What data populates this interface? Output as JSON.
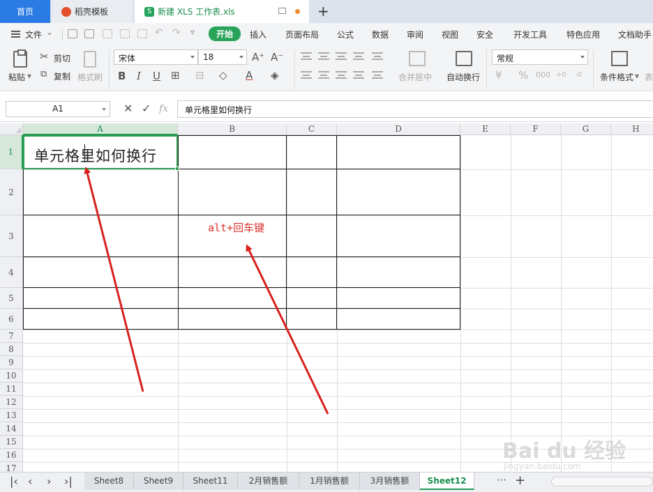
{
  "titlebar": {
    "tabs": [
      {
        "label": "首页",
        "active": false
      },
      {
        "label": "稻壳模板",
        "active": false
      },
      {
        "label": "新建 XLS 工作表.xls",
        "active": true
      }
    ],
    "new_tab_label": "+"
  },
  "menubar": {
    "file_label": "文件",
    "tabs": [
      "开始",
      "插入",
      "页面布局",
      "公式",
      "数据",
      "审阅",
      "视图",
      "安全",
      "开发工具",
      "特色应用",
      "文档助手"
    ],
    "active_tab": "开始"
  },
  "ribbon": {
    "paste": "粘贴",
    "cut": "剪切",
    "copy": "复制",
    "format_painter": "格式刷",
    "font_name": "宋体",
    "font_size": "18",
    "grow_font": "A⁺",
    "shrink_font": "A⁻",
    "bold": "B",
    "italic": "I",
    "underline": "U",
    "merge_center": "合并居中",
    "auto_wrap": "自动换行",
    "number_format": "常规",
    "percent": "%",
    "cond_format": "条件格式",
    "table_style": "表"
  },
  "formulabar": {
    "cell_ref": "A1",
    "cancel": "✕",
    "confirm": "✓",
    "fx": "fx",
    "value": "单元格里如何换行"
  },
  "grid": {
    "columns": [
      "A",
      "B",
      "C",
      "D",
      "E",
      "F",
      "G",
      "H"
    ],
    "selected_column": "A",
    "rows": [
      "1",
      "2",
      "3",
      "4",
      "5",
      "6",
      "7",
      "8",
      "9",
      "10",
      "11",
      "12",
      "13",
      "14",
      "15",
      "16",
      "17"
    ],
    "selected_row": "1",
    "active_cell": "A1",
    "cells": {
      "A1": "单元格里如何换行"
    },
    "annotation": "alt+回车键"
  },
  "sheets": {
    "tabs": [
      "Sheet8",
      "Sheet9",
      "Sheet11",
      "2月销售额",
      "1月销售额",
      "3月销售额",
      "Sheet12"
    ],
    "active": "Sheet12",
    "more_label": "⋯",
    "add_label": "+"
  },
  "watermark": {
    "brand": "Bai du 经验",
    "url": "jingyan.baidu.com"
  },
  "colors": {
    "accent_green": "#27a35a",
    "home_tab_blue": "#2b7be5",
    "arrow_red": "#d8201c"
  }
}
